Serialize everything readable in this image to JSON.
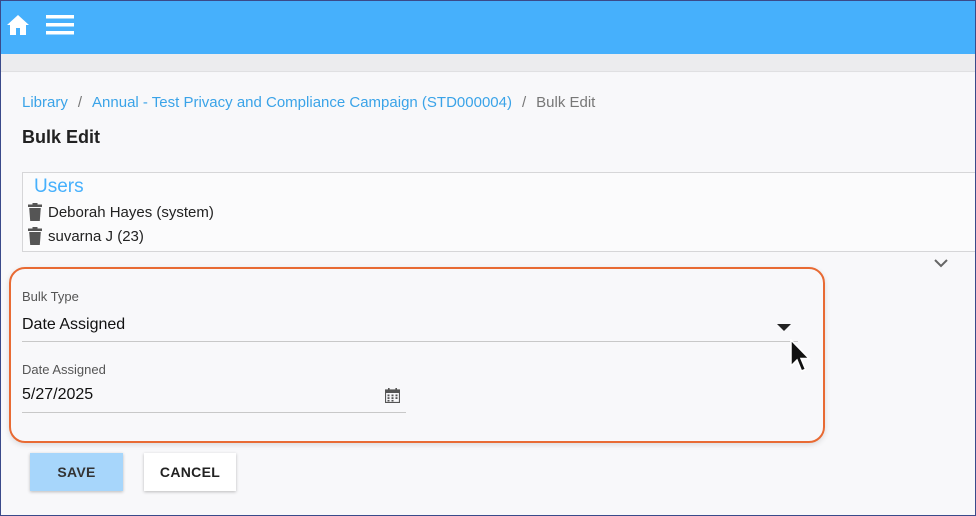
{
  "breadcrumb": {
    "library": "Library",
    "separator": "/",
    "campaign": "Annual - Test Privacy and Compliance Campaign (STD000004)",
    "current": "Bulk Edit"
  },
  "page_title": "Bulk Edit",
  "users": {
    "title": "Users",
    "items": [
      {
        "name": "Deborah Hayes (system)"
      },
      {
        "name": "suvarna J (23)"
      }
    ]
  },
  "form": {
    "bulk_type_label": "Bulk Type",
    "bulk_type_value": "Date Assigned",
    "date_assigned_label": "Date Assigned",
    "date_assigned_value": "5/27/2025"
  },
  "buttons": {
    "save": "SAVE",
    "cancel": "CANCEL"
  },
  "colors": {
    "topbar": "#46b0fc",
    "link": "#3aa3e8",
    "highlight_border": "#e86a33",
    "save_button": "#a7d6fb"
  },
  "icons": {
    "home": "home-icon",
    "menu": "hamburger-menu-icon",
    "delete": "trash-icon",
    "expand": "chevron-down-icon",
    "dropdown": "caret-down-icon",
    "calendar": "calendar-icon"
  }
}
